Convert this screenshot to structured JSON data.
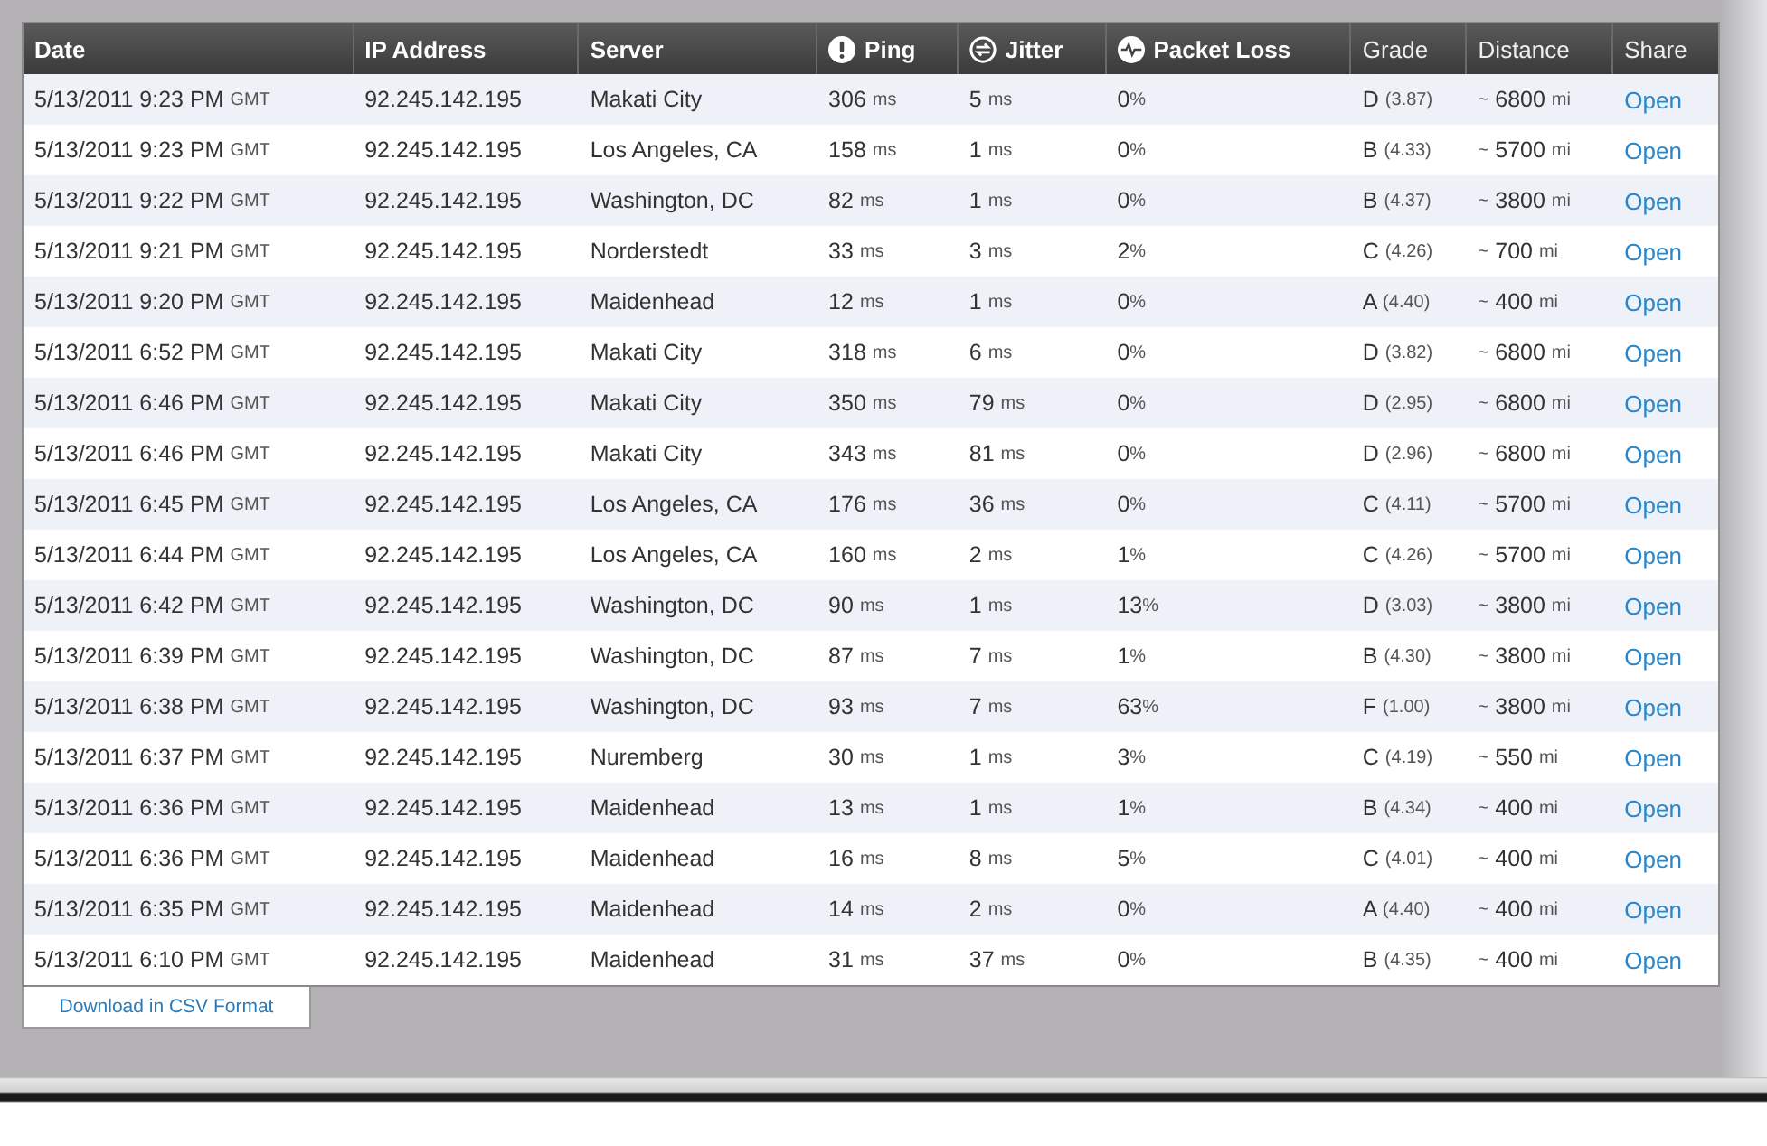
{
  "table": {
    "columns": [
      {
        "label": "Date",
        "kind": "plain"
      },
      {
        "label": "IP Address",
        "kind": "plain"
      },
      {
        "label": "Server",
        "kind": "plain"
      },
      {
        "label": "Ping",
        "kind": "ping"
      },
      {
        "label": "Jitter",
        "kind": "jitter"
      },
      {
        "label": "Packet Loss",
        "kind": "loss"
      },
      {
        "label": "Grade",
        "kind": "light"
      },
      {
        "label": "Distance",
        "kind": "light"
      },
      {
        "label": "Share",
        "kind": "light"
      }
    ],
    "rows": [
      {
        "date": "5/13/2011 9:23 PM",
        "tz": "GMT",
        "ip": "92.245.142.195",
        "server": "Makati City",
        "ping": "306",
        "ping_unit": "ms",
        "jitter": "5",
        "jitter_unit": "ms",
        "loss": "0",
        "loss_unit": "%",
        "grade": "D",
        "score": "(3.87)",
        "approx": "~",
        "distance": "6800",
        "distance_unit": "mi",
        "share": "Open"
      },
      {
        "date": "5/13/2011 9:23 PM",
        "tz": "GMT",
        "ip": "92.245.142.195",
        "server": "Los Angeles, CA",
        "ping": "158",
        "ping_unit": "ms",
        "jitter": "1",
        "jitter_unit": "ms",
        "loss": "0",
        "loss_unit": "%",
        "grade": "B",
        "score": "(4.33)",
        "approx": "~",
        "distance": "5700",
        "distance_unit": "mi",
        "share": "Open"
      },
      {
        "date": "5/13/2011 9:22 PM",
        "tz": "GMT",
        "ip": "92.245.142.195",
        "server": "Washington, DC",
        "ping": "82",
        "ping_unit": "ms",
        "jitter": "1",
        "jitter_unit": "ms",
        "loss": "0",
        "loss_unit": "%",
        "grade": "B",
        "score": "(4.37)",
        "approx": "~",
        "distance": "3800",
        "distance_unit": "mi",
        "share": "Open"
      },
      {
        "date": "5/13/2011 9:21 PM",
        "tz": "GMT",
        "ip": "92.245.142.195",
        "server": "Norderstedt",
        "ping": "33",
        "ping_unit": "ms",
        "jitter": "3",
        "jitter_unit": "ms",
        "loss": "2",
        "loss_unit": "%",
        "grade": "C",
        "score": "(4.26)",
        "approx": "~",
        "distance": "700",
        "distance_unit": "mi",
        "share": "Open"
      },
      {
        "date": "5/13/2011 9:20 PM",
        "tz": "GMT",
        "ip": "92.245.142.195",
        "server": "Maidenhead",
        "ping": "12",
        "ping_unit": "ms",
        "jitter": "1",
        "jitter_unit": "ms",
        "loss": "0",
        "loss_unit": "%",
        "grade": "A",
        "score": "(4.40)",
        "approx": "~",
        "distance": "400",
        "distance_unit": "mi",
        "share": "Open"
      },
      {
        "date": "5/13/2011 6:52 PM",
        "tz": "GMT",
        "ip": "92.245.142.195",
        "server": "Makati City",
        "ping": "318",
        "ping_unit": "ms",
        "jitter": "6",
        "jitter_unit": "ms",
        "loss": "0",
        "loss_unit": "%",
        "grade": "D",
        "score": "(3.82)",
        "approx": "~",
        "distance": "6800",
        "distance_unit": "mi",
        "share": "Open"
      },
      {
        "date": "5/13/2011 6:46 PM",
        "tz": "GMT",
        "ip": "92.245.142.195",
        "server": "Makati City",
        "ping": "350",
        "ping_unit": "ms",
        "jitter": "79",
        "jitter_unit": "ms",
        "loss": "0",
        "loss_unit": "%",
        "grade": "D",
        "score": "(2.95)",
        "approx": "~",
        "distance": "6800",
        "distance_unit": "mi",
        "share": "Open"
      },
      {
        "date": "5/13/2011 6:46 PM",
        "tz": "GMT",
        "ip": "92.245.142.195",
        "server": "Makati City",
        "ping": "343",
        "ping_unit": "ms",
        "jitter": "81",
        "jitter_unit": "ms",
        "loss": "0",
        "loss_unit": "%",
        "grade": "D",
        "score": "(2.96)",
        "approx": "~",
        "distance": "6800",
        "distance_unit": "mi",
        "share": "Open"
      },
      {
        "date": "5/13/2011 6:45 PM",
        "tz": "GMT",
        "ip": "92.245.142.195",
        "server": "Los Angeles, CA",
        "ping": "176",
        "ping_unit": "ms",
        "jitter": "36",
        "jitter_unit": "ms",
        "loss": "0",
        "loss_unit": "%",
        "grade": "C",
        "score": "(4.11)",
        "approx": "~",
        "distance": "5700",
        "distance_unit": "mi",
        "share": "Open"
      },
      {
        "date": "5/13/2011 6:44 PM",
        "tz": "GMT",
        "ip": "92.245.142.195",
        "server": "Los Angeles, CA",
        "ping": "160",
        "ping_unit": "ms",
        "jitter": "2",
        "jitter_unit": "ms",
        "loss": "1",
        "loss_unit": "%",
        "grade": "C",
        "score": "(4.26)",
        "approx": "~",
        "distance": "5700",
        "distance_unit": "mi",
        "share": "Open"
      },
      {
        "date": "5/13/2011 6:42 PM",
        "tz": "GMT",
        "ip": "92.245.142.195",
        "server": "Washington, DC",
        "ping": "90",
        "ping_unit": "ms",
        "jitter": "1",
        "jitter_unit": "ms",
        "loss": "13",
        "loss_unit": "%",
        "grade": "D",
        "score": "(3.03)",
        "approx": "~",
        "distance": "3800",
        "distance_unit": "mi",
        "share": "Open"
      },
      {
        "date": "5/13/2011 6:39 PM",
        "tz": "GMT",
        "ip": "92.245.142.195",
        "server": "Washington, DC",
        "ping": "87",
        "ping_unit": "ms",
        "jitter": "7",
        "jitter_unit": "ms",
        "loss": "1",
        "loss_unit": "%",
        "grade": "B",
        "score": "(4.30)",
        "approx": "~",
        "distance": "3800",
        "distance_unit": "mi",
        "share": "Open"
      },
      {
        "date": "5/13/2011 6:38 PM",
        "tz": "GMT",
        "ip": "92.245.142.195",
        "server": "Washington, DC",
        "ping": "93",
        "ping_unit": "ms",
        "jitter": "7",
        "jitter_unit": "ms",
        "loss": "63",
        "loss_unit": "%",
        "grade": "F",
        "score": "(1.00)",
        "approx": "~",
        "distance": "3800",
        "distance_unit": "mi",
        "share": "Open"
      },
      {
        "date": "5/13/2011 6:37 PM",
        "tz": "GMT",
        "ip": "92.245.142.195",
        "server": "Nuremberg",
        "ping": "30",
        "ping_unit": "ms",
        "jitter": "1",
        "jitter_unit": "ms",
        "loss": "3",
        "loss_unit": "%",
        "grade": "C",
        "score": "(4.19)",
        "approx": "~",
        "distance": "550",
        "distance_unit": "mi",
        "share": "Open"
      },
      {
        "date": "5/13/2011 6:36 PM",
        "tz": "GMT",
        "ip": "92.245.142.195",
        "server": "Maidenhead",
        "ping": "13",
        "ping_unit": "ms",
        "jitter": "1",
        "jitter_unit": "ms",
        "loss": "1",
        "loss_unit": "%",
        "grade": "B",
        "score": "(4.34)",
        "approx": "~",
        "distance": "400",
        "distance_unit": "mi",
        "share": "Open"
      },
      {
        "date": "5/13/2011 6:36 PM",
        "tz": "GMT",
        "ip": "92.245.142.195",
        "server": "Maidenhead",
        "ping": "16",
        "ping_unit": "ms",
        "jitter": "8",
        "jitter_unit": "ms",
        "loss": "5",
        "loss_unit": "%",
        "grade": "C",
        "score": "(4.01)",
        "approx": "~",
        "distance": "400",
        "distance_unit": "mi",
        "share": "Open"
      },
      {
        "date": "5/13/2011 6:35 PM",
        "tz": "GMT",
        "ip": "92.245.142.195",
        "server": "Maidenhead",
        "ping": "14",
        "ping_unit": "ms",
        "jitter": "2",
        "jitter_unit": "ms",
        "loss": "0",
        "loss_unit": "%",
        "grade": "A",
        "score": "(4.40)",
        "approx": "~",
        "distance": "400",
        "distance_unit": "mi",
        "share": "Open"
      },
      {
        "date": "5/13/2011 6:10 PM",
        "tz": "GMT",
        "ip": "92.245.142.195",
        "server": "Maidenhead",
        "ping": "31",
        "ping_unit": "ms",
        "jitter": "37",
        "jitter_unit": "ms",
        "loss": "0",
        "loss_unit": "%",
        "grade": "B",
        "score": "(4.35)",
        "approx": "~",
        "distance": "400",
        "distance_unit": "mi",
        "share": "Open"
      }
    ]
  },
  "download_button": "Download in CSV Format"
}
